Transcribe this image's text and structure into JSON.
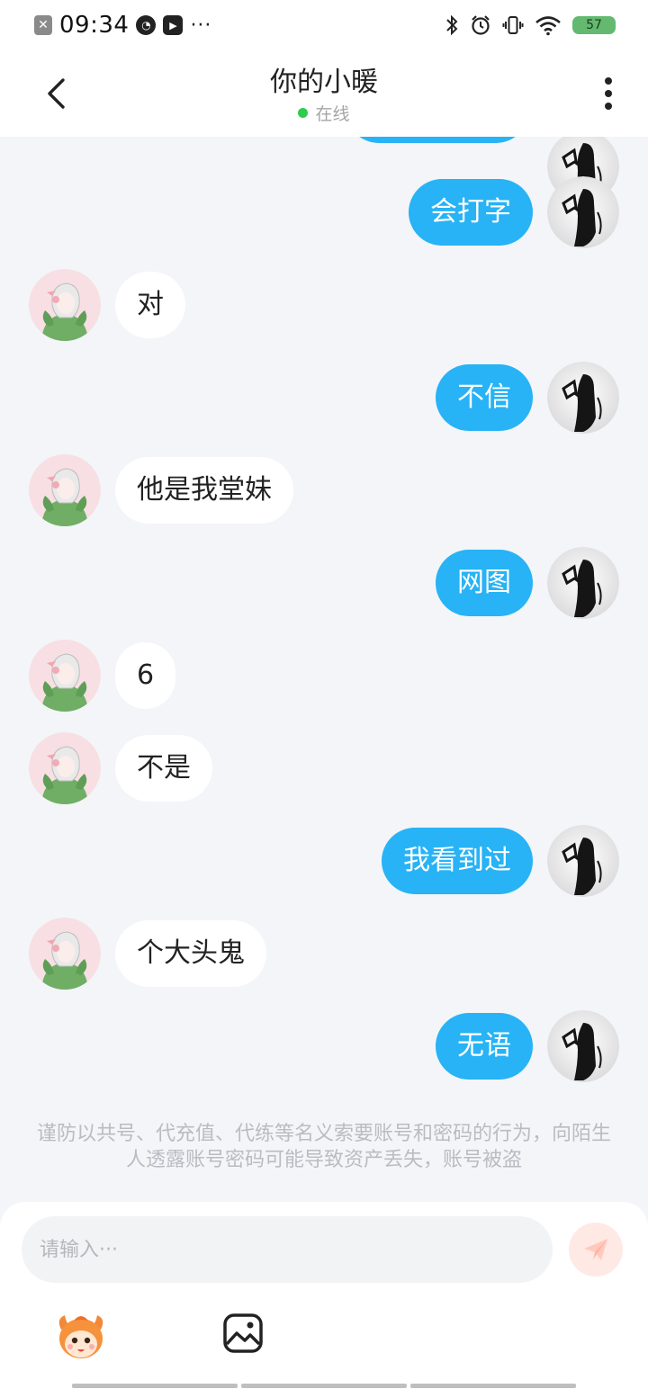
{
  "status_bar": {
    "time": "09:34",
    "more": "···",
    "battery": "57",
    "icons": [
      "close-box-icon",
      "speedometer-icon",
      "play-box-icon",
      "bluetooth-icon",
      "alarm-icon",
      "vibrate-icon",
      "wifi-icon",
      "battery-icon"
    ]
  },
  "header": {
    "title": "你的小暖",
    "status": "在线",
    "status_color": "#2ecc4f"
  },
  "messages": [
    {
      "side": "right",
      "text": ""
    },
    {
      "side": "right",
      "text": "会打字"
    },
    {
      "side": "left",
      "text": "对"
    },
    {
      "side": "right",
      "text": "不信"
    },
    {
      "side": "left",
      "text": "他是我堂妹"
    },
    {
      "side": "right",
      "text": "网图"
    },
    {
      "side": "left",
      "text": "6"
    },
    {
      "side": "left",
      "text": "不是"
    },
    {
      "side": "right",
      "text": "我看到过"
    },
    {
      "side": "left",
      "text": "个大头鬼"
    },
    {
      "side": "right",
      "text": "无语"
    }
  ],
  "warning": "谨防以共号、代充值、代练等名义索要账号和密码的行为，向陌生人透露账号密码可能导致资产丢失，账号被盗",
  "composer": {
    "placeholder": "请输入···",
    "accent_color": "#27b3f5",
    "send_color": "#ffe9e4"
  }
}
